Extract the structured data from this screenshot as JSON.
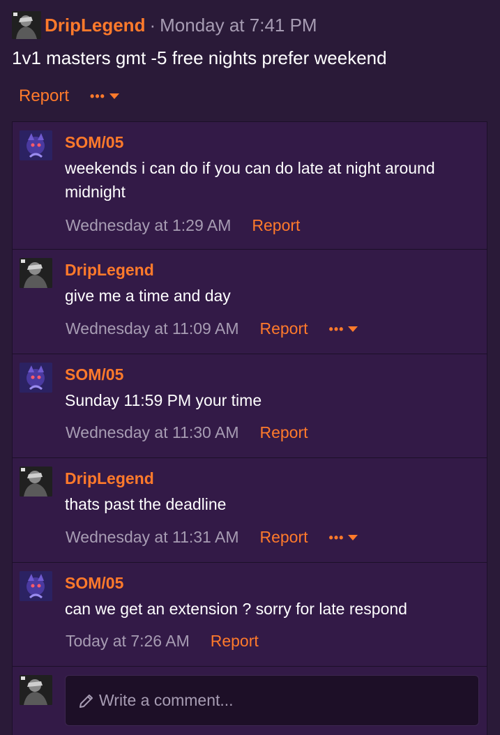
{
  "post": {
    "author": "DripLegend",
    "separator": "·",
    "time": "Monday at 7:41 PM",
    "body": "1v1 masters gmt -5 free nights prefer weekend",
    "report_label": "Report",
    "more_label": "•••"
  },
  "comments": [
    {
      "author": "SOM/05",
      "text": "weekends i can do if you can do late at night around midnight",
      "time": "Wednesday at 1:29 AM",
      "report_label": "Report"
    },
    {
      "author": "DripLegend",
      "text": "give me a time and day",
      "time": "Wednesday at 11:09 AM",
      "report_label": "Report",
      "more_label": "•••"
    },
    {
      "author": "SOM/05",
      "text": "Sunday 11:59 PM your time",
      "time": "Wednesday at 11:30 AM",
      "report_label": "Report"
    },
    {
      "author": "DripLegend",
      "text": "thats past the deadline",
      "time": "Wednesday at 11:31 AM",
      "report_label": "Report",
      "more_label": "•••"
    },
    {
      "author": "SOM/05",
      "text": "can we get an extension ? sorry for late respond",
      "time": "Today at 7:26 AM",
      "report_label": "Report"
    }
  ],
  "composer": {
    "placeholder": "Write a comment..."
  },
  "colors": {
    "accent": "#ff7a2b",
    "background": "#2a1a38",
    "comment_bg": "#331a47",
    "muted_text": "#a79cb3"
  },
  "icons": {
    "user_avatar": "avatar-icon",
    "more_menu": "ellipsis-caret-icon",
    "compose": "pencil-icon"
  }
}
